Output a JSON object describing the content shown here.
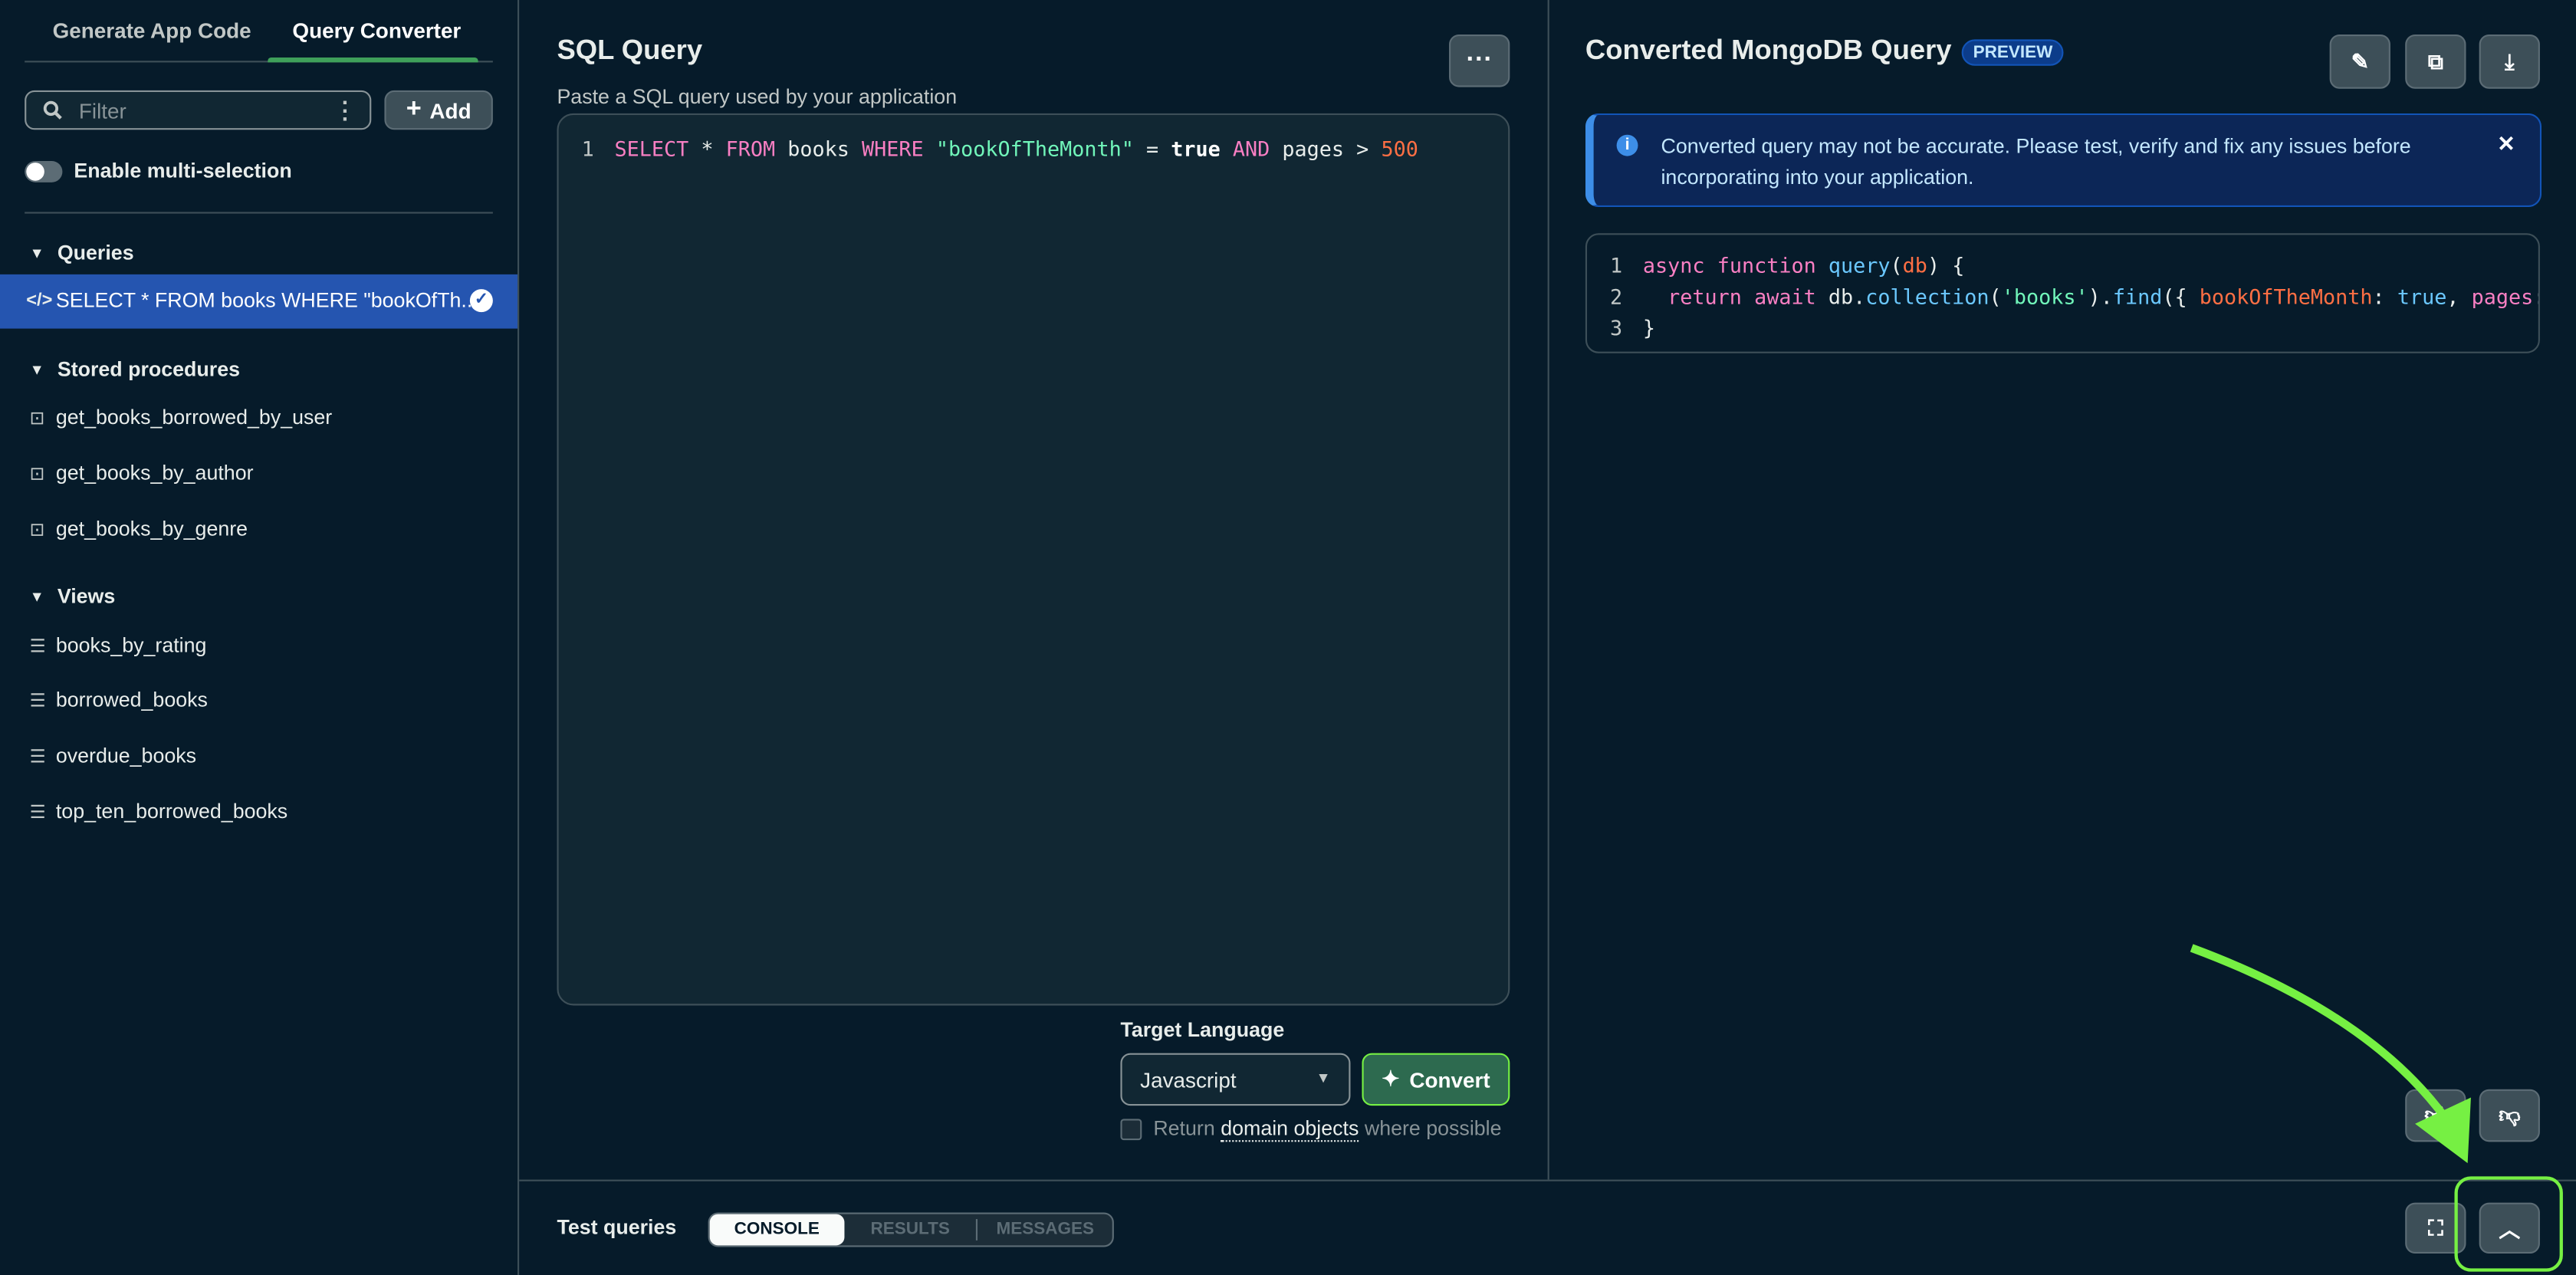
{
  "sidebar": {
    "tabs": [
      {
        "label": "Generate App Code"
      },
      {
        "label": "Query Converter",
        "active": true
      }
    ],
    "filter_placeholder": "Filter",
    "add_label": "Add",
    "multi_select_label": "Enable multi-selection",
    "multi_select_on": false,
    "queries": {
      "title": "Queries",
      "items": [
        {
          "label": "SELECT * FROM books WHERE \"bookOfTh...",
          "selected": true
        }
      ]
    },
    "stored_procedures": {
      "title": "Stored procedures",
      "items": [
        {
          "label": "get_books_borrowed_by_user"
        },
        {
          "label": "get_books_by_author"
        },
        {
          "label": "get_books_by_genre"
        }
      ]
    },
    "views": {
      "title": "Views",
      "items": [
        {
          "label": "books_by_rating"
        },
        {
          "label": "borrowed_books"
        },
        {
          "label": "overdue_books"
        },
        {
          "label": "top_ten_borrowed_books"
        }
      ]
    }
  },
  "sql": {
    "title": "SQL Query",
    "subtitle": "Paste a SQL query used by your application",
    "lines": [
      {
        "n": "1",
        "tokens": [
          [
            "k",
            "SELECT"
          ],
          [
            "p",
            " * "
          ],
          [
            "k",
            "FROM"
          ],
          [
            "p",
            " books "
          ],
          [
            "k",
            "WHERE"
          ],
          [
            "p",
            " "
          ],
          [
            "s",
            "\"bookOfTheMonth\""
          ],
          [
            "p",
            " = "
          ],
          [
            "b",
            "true"
          ],
          [
            "p",
            " "
          ],
          [
            "k",
            "AND"
          ],
          [
            "p",
            " pages > "
          ],
          [
            "n",
            "500"
          ]
        ]
      }
    ],
    "target_language_label": "Target Language",
    "target_language": "Javascript",
    "convert_label": "Convert",
    "return_prefix": "Return",
    "return_link": "domain objects",
    "return_suffix": "where possible"
  },
  "result": {
    "title": "Converted MongoDB Query",
    "badge": "PREVIEW",
    "alert": "Converted query may not be accurate. Please test, verify and fix any issues before incorporating into your application.",
    "lines": [
      {
        "n": "1",
        "tokens": [
          [
            "k",
            "async"
          ],
          [
            "p",
            " "
          ],
          [
            "k",
            "function"
          ],
          [
            "p",
            " "
          ],
          [
            "f",
            "query"
          ],
          [
            "p",
            "("
          ],
          [
            "v",
            "db"
          ],
          [
            "p",
            ") {"
          ]
        ]
      },
      {
        "n": "2",
        "tokens": [
          [
            "p",
            "  "
          ],
          [
            "k",
            "return"
          ],
          [
            "p",
            " "
          ],
          [
            "k",
            "await"
          ],
          [
            "p",
            " db."
          ],
          [
            "f",
            "collection"
          ],
          [
            "p",
            "("
          ],
          [
            "s",
            "'books'"
          ],
          [
            "p",
            ")."
          ],
          [
            "f",
            "find"
          ],
          [
            "p",
            "({ "
          ],
          [
            "v",
            "bookOfTheMonth"
          ],
          [
            "p",
            ": "
          ],
          [
            "f",
            "true"
          ],
          [
            "p",
            ", "
          ],
          [
            "k",
            "pages"
          ],
          [
            "p",
            ": {"
          ]
        ]
      },
      {
        "n": "3",
        "tokens": [
          [
            "p",
            "}"
          ]
        ]
      }
    ]
  },
  "bottom": {
    "title": "Test queries",
    "tabs": [
      {
        "label": "CONSOLE",
        "active": true
      },
      {
        "label": "RESULTS"
      },
      {
        "label": "MESSAGES"
      }
    ]
  },
  "colors": {
    "accent": "#3fa05a",
    "selected": "#2555b0",
    "annotation": "#76f043"
  }
}
